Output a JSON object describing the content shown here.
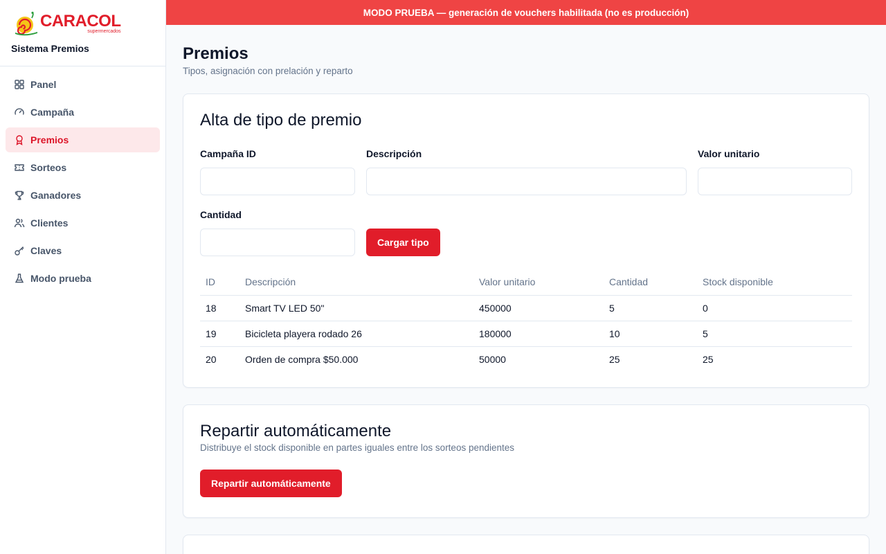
{
  "brand": {
    "logo_text": "CARACOL",
    "logo_sub": "supermercados",
    "app_name": "Sistema Premios",
    "logo_color": "#e11d2a"
  },
  "nav": [
    {
      "label": "Panel",
      "icon": "grid-icon",
      "active": false
    },
    {
      "label": "Campaña",
      "icon": "gauge-icon",
      "active": false
    },
    {
      "label": "Premios",
      "icon": "award-icon",
      "active": true
    },
    {
      "label": "Sorteos",
      "icon": "ticket-icon",
      "active": false
    },
    {
      "label": "Ganadores",
      "icon": "trophy-icon",
      "active": false
    },
    {
      "label": "Clientes",
      "icon": "users-icon",
      "active": false
    },
    {
      "label": "Claves",
      "icon": "key-icon",
      "active": false
    },
    {
      "label": "Modo prueba",
      "icon": "flask-icon",
      "active": false
    }
  ],
  "banner": {
    "text": "MODO PRUEBA — generación de vouchers habilitada (no es producción)",
    "color": "#ef4444"
  },
  "page": {
    "title": "Premios",
    "subtitle": "Tipos, asignación con prelación y reparto"
  },
  "alta": {
    "title": "Alta de tipo de premio",
    "fields": {
      "campana_label": "Campaña ID",
      "campana_value": "",
      "descripcion_label": "Descripción",
      "descripcion_value": "",
      "valor_label": "Valor unitario",
      "valor_value": "",
      "cantidad_label": "Cantidad",
      "cantidad_value": ""
    },
    "submit_label": "Cargar tipo",
    "table": {
      "headers": [
        "ID",
        "Descripción",
        "Valor unitario",
        "Cantidad",
        "Stock disponible"
      ],
      "rows": [
        [
          "18",
          "Smart TV LED 50\"",
          "450000",
          "5",
          "0"
        ],
        [
          "19",
          "Bicicleta playera rodado 26",
          "180000",
          "10",
          "5"
        ],
        [
          "20",
          "Orden de compra $50.000",
          "50000",
          "25",
          "25"
        ]
      ]
    }
  },
  "reparto": {
    "title": "Repartir automáticamente",
    "subtitle": "Distribuye el stock disponible en partes iguales entre los sorteos pendientes",
    "button_label": "Repartir automáticamente"
  },
  "accent_color": "#e11d2a"
}
